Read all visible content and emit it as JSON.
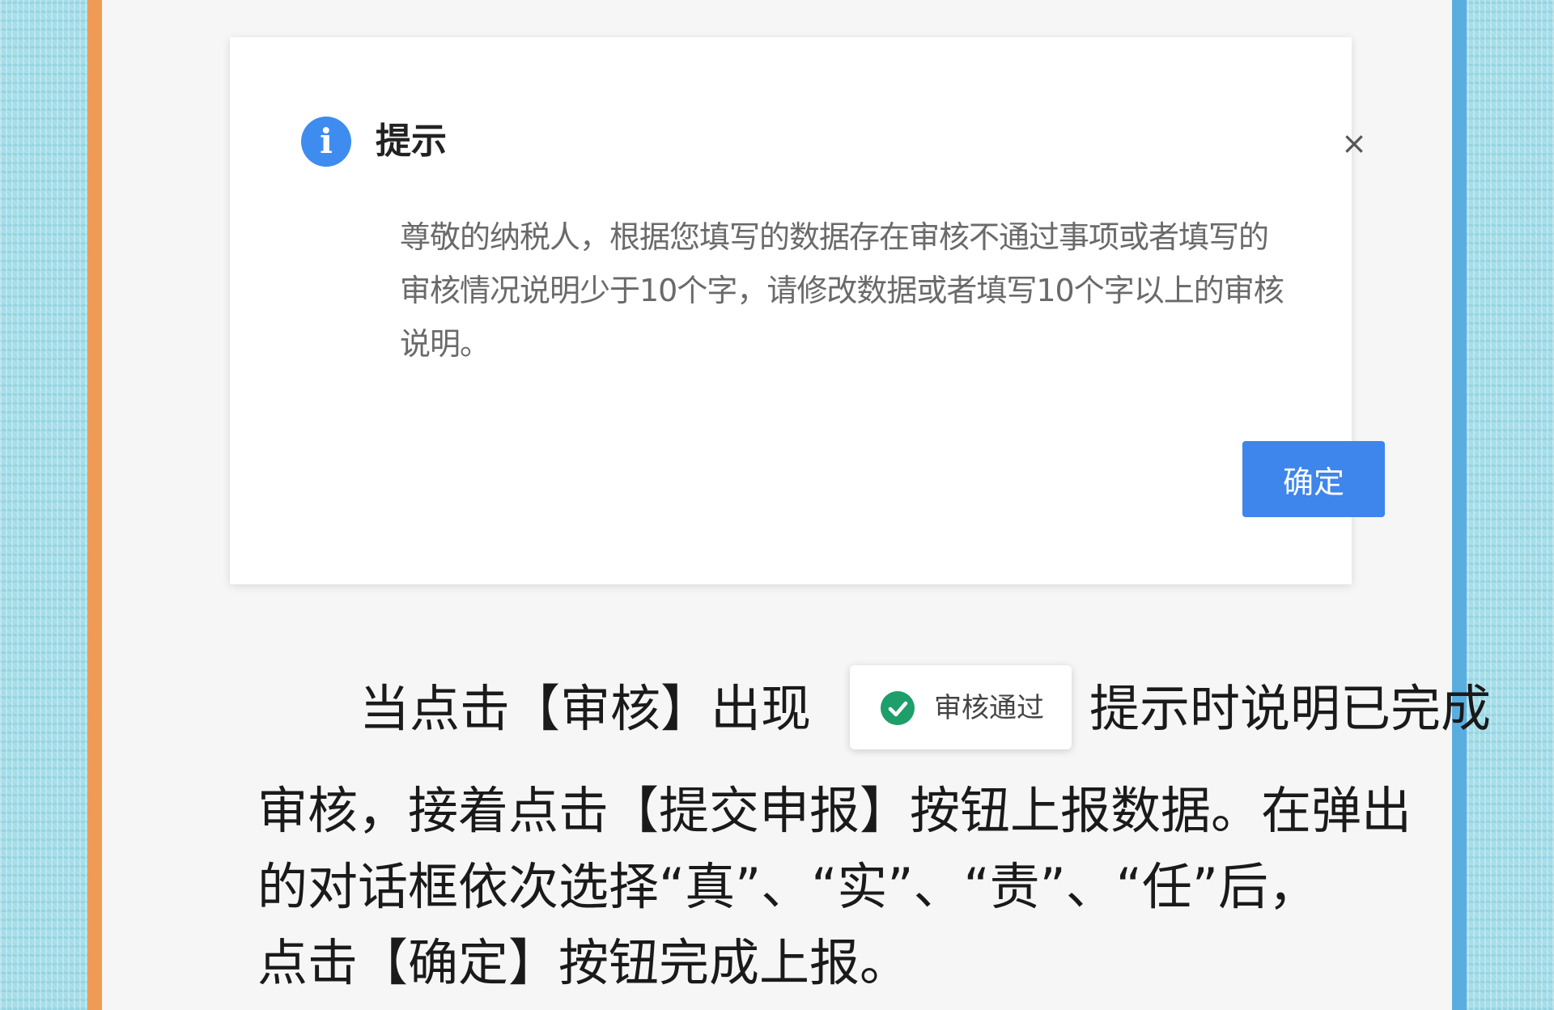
{
  "dialog": {
    "icon": "info-icon",
    "title": "提示",
    "close_label": "×",
    "message_lines": [
      "尊敬的纳税人，根据您填写的数据存在审核不通过事项或者填写的",
      "审核情况说明少于10个字，请修改数据或者填写10个字以上的审核",
      "说明。"
    ],
    "confirm_label": "确定"
  },
  "toast": {
    "icon": "check-circle-icon",
    "text": "审核通过"
  },
  "instructions": {
    "line1_before": "当点击【审核】出现",
    "line1_after": "提示时说明已完成",
    "line2": "审核，接着点击【提交申报】按钮上报数据。在弹出",
    "line3": "的对话框依次选择“真”、“实”、“责”、“任”后，",
    "line4": "点击【确定】按钮完成上报。"
  },
  "colors": {
    "primary_blue": "#3e85ec",
    "success_green": "#1e9e6a",
    "left_stripe": "#ef9b55",
    "right_stripe": "#5aaedf"
  }
}
